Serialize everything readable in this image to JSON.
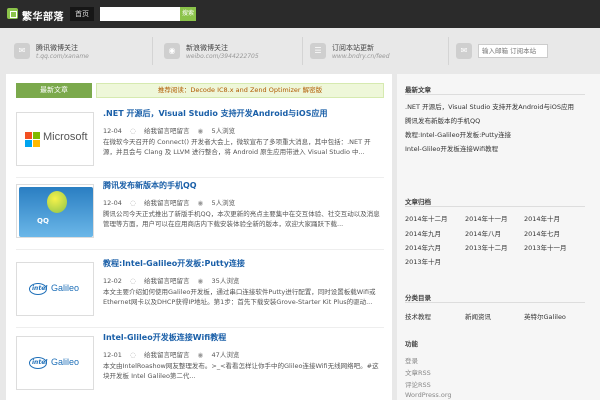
{
  "header": {
    "site_name": "繁华部落",
    "nav_home": "首页",
    "search_placeholder": "",
    "search_button": "搜索"
  },
  "social": [
    {
      "icon": "qq-weibo-icon",
      "glyph": "✉",
      "title": "腾讯微博关注",
      "sub": "t.qq.com/xaname"
    },
    {
      "icon": "sina-weibo-icon",
      "glyph": "◉",
      "title": "新浪微博关注",
      "sub": "weibo.com/3944222705"
    },
    {
      "icon": "rss-icon",
      "glyph": "☰",
      "title": "订阅本站更新",
      "sub": "www.bndry.cn/feed"
    },
    {
      "icon": "mail-icon",
      "glyph": "✉",
      "title": "",
      "sub": ""
    }
  ],
  "subscribe_placeholder": "输入邮箱 订阅本站",
  "main": {
    "tab_label": "最新文章",
    "notice": "推荐阅读：Decode IC8.x and Zend Optimizer 解密版"
  },
  "posts": [
    {
      "title": ".NET 开源后，Visual Studio 支持开发Android与iOS应用",
      "date": "12-04",
      "comments": "给我留言吧留言",
      "views": "5人浏览",
      "excerpt": "在微软今天召开的 Connect() 开发者大会上，微软宣布了多项重大消息，其中包括：.NET 开源，并且会与 Clang 及 LLVM 进行整合，将 Android 原生应用带进入 Visual Studio 中..."
    },
    {
      "title": "腾讯发布新版本的手机QQ",
      "date": "12-04",
      "comments": "给我留言吧留言",
      "views": "5人浏览",
      "excerpt": "腾讯公司今天正式推出了新版手机QQ，本次更新的亮点主要集中在交互体验、社交互动以及消息管理等方面，用户可以在应用商店内下载安装体验全新的版本，欢迎大家踊跃下载..."
    },
    {
      "title": "教程:Intel-Galileo开发板:Putty连接",
      "date": "12-02",
      "comments": "给我留言吧留言",
      "views": "35人浏览",
      "excerpt": "本文主要介绍如何使用Galileo开发板，通过串口连接软件Putty进行配置，同时设置板载Wifi或Ethernet网卡以及DHCP获得IP地址。第1步：首先下载安装Grove-Starter Kit Plus的驱动..."
    },
    {
      "title": "Intel-Glileo开发板连接Wifi教程",
      "date": "12-01",
      "comments": "给我留言吧留言",
      "views": "47人浏览",
      "excerpt": "本文由IntelRoashow网友整理发布。>_<看看怎样让你手中的Glileo连接Wifi无线网络吧。#这块开发板 Intel Galileo第二代..."
    }
  ],
  "sidebar": {
    "recent_title": "最新文章",
    "recent": [
      ".NET 开源后，Visual Studio 支持开发Android与iOS应用",
      "腾讯发布新版本的手机QQ",
      "教程:Intel-Galileo开发板:Putty连接",
      "Intel-Glileo开发板连接Wifi教程"
    ],
    "archive_title": "文章归档",
    "archives": [
      "2014年十二月",
      "2014年十一月",
      "2014年十月",
      "2014年九月",
      "2014年八月",
      "2014年七月",
      "2014年六月",
      "2013年十二月",
      "2013年十一月",
      "2013年十月"
    ],
    "categories_title": "分类目录",
    "categories": [
      "技术教程",
      "新闻资讯",
      "英特尔Galileo"
    ],
    "meta_title": "功能",
    "meta": [
      "登录",
      "文章RSS",
      "评论RSS",
      "WordPress.org"
    ]
  }
}
